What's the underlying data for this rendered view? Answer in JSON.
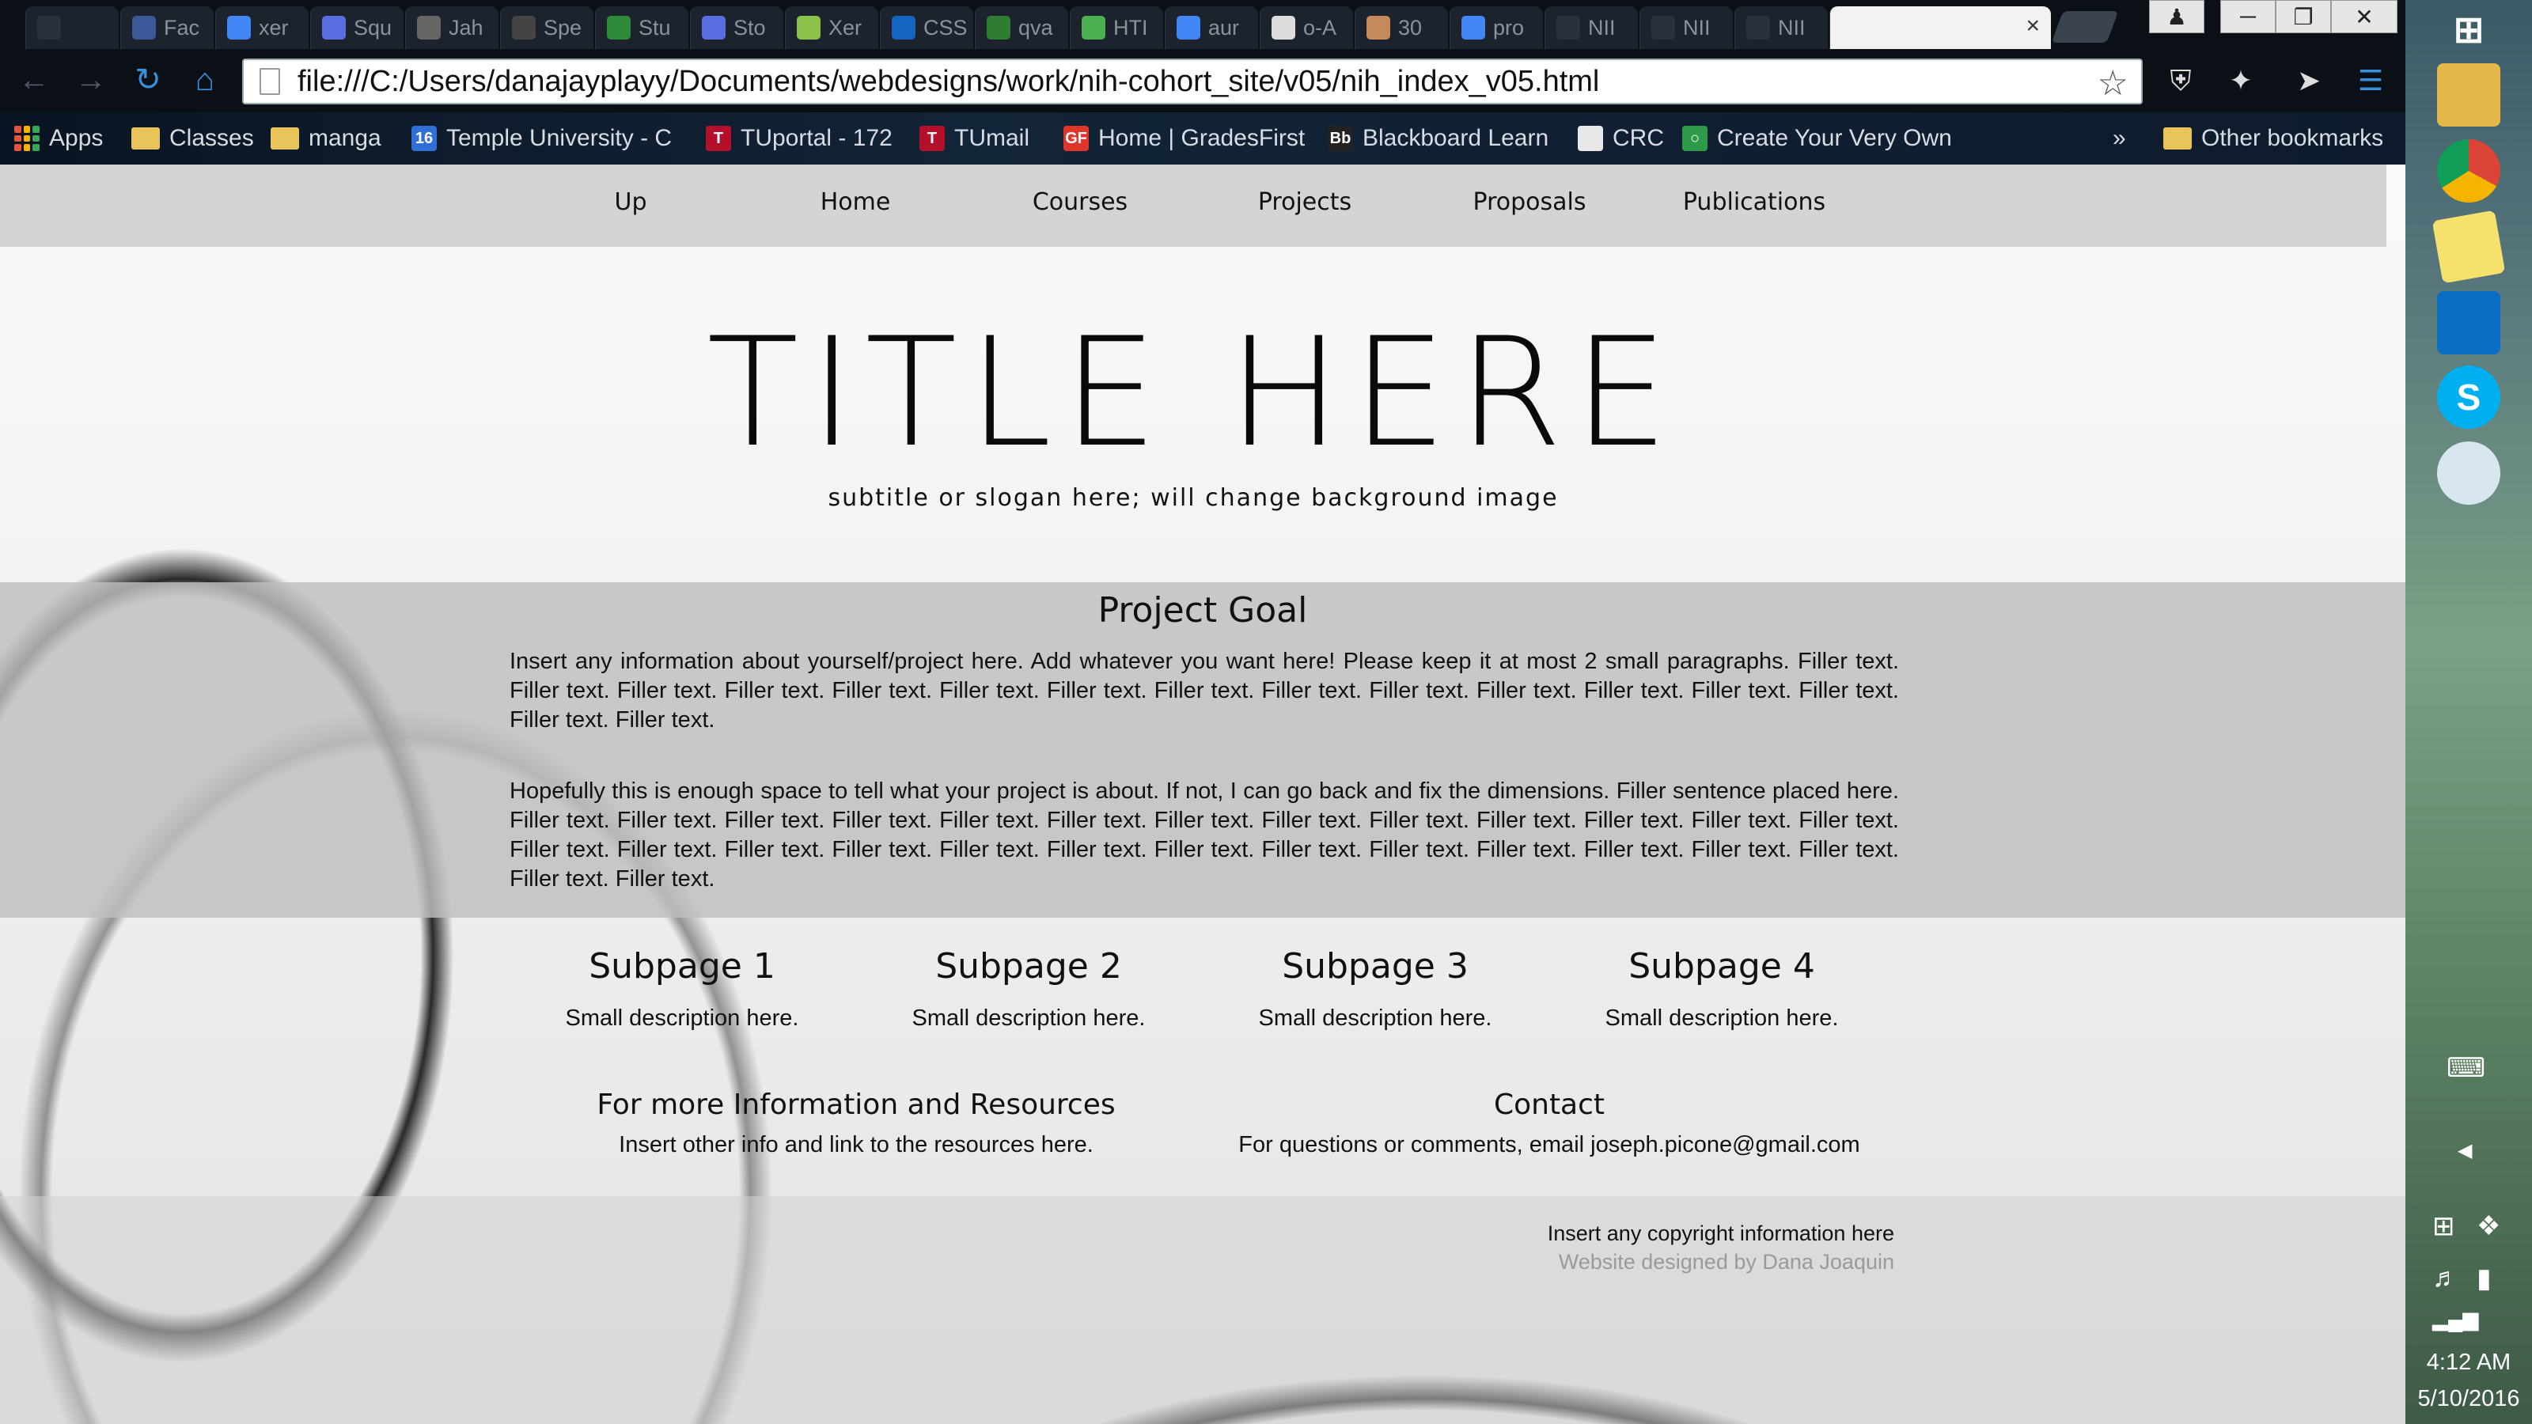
{
  "browser": {
    "tabs": [
      {
        "title": "",
        "favicon": "blank-page-icon",
        "color": "#2a313b"
      },
      {
        "title": "Fac",
        "favicon": "facebook-icon",
        "color": "#3b5998"
      },
      {
        "title": "xer",
        "favicon": "google-icon",
        "color": "#4285f4"
      },
      {
        "title": "Squ",
        "favicon": "gradient-g-icon",
        "color": "#5b6ee1"
      },
      {
        "title": "Jah",
        "favicon": "scissors-icon",
        "color": "#666666"
      },
      {
        "title": "Spe",
        "favicon": "check-icon",
        "color": "#444444"
      },
      {
        "title": "Stu",
        "favicon": "green-star-icon",
        "color": "#2e8b3a"
      },
      {
        "title": "Sto",
        "favicon": "gradient-g-icon",
        "color": "#5b6ee1"
      },
      {
        "title": "Xer",
        "favicon": "green-d-icon",
        "color": "#8bc34a"
      },
      {
        "title": "CSS",
        "favicon": "w3-icon",
        "color": "#1565c0"
      },
      {
        "title": "qva",
        "favicon": "green-circle-icon",
        "color": "#2e7d32"
      },
      {
        "title": "HTI",
        "favicon": "w3-green-icon",
        "color": "#4caf50"
      },
      {
        "title": "aur",
        "favicon": "google-icon",
        "color": "#4285f4"
      },
      {
        "title": "o-A",
        "favicon": "h-icon",
        "color": "#dddddd"
      },
      {
        "title": "30",
        "favicon": "avatar-icon",
        "color": "#c48a5a"
      },
      {
        "title": "pro",
        "favicon": "google-icon",
        "color": "#4285f4"
      },
      {
        "title": "NII",
        "favicon": "blank-page-icon",
        "color": "#2a313b"
      },
      {
        "title": "NII",
        "favicon": "blank-page-icon",
        "color": "#2a313b"
      },
      {
        "title": "NII",
        "favicon": "blank-page-icon",
        "color": "#2a313b"
      },
      {
        "title": "",
        "favicon": "blank-page-icon",
        "color": "#f2f2f2",
        "active": true
      }
    ],
    "url": "file:///C:/Users/danajayplayy/Documents/webdesigns/work/nih-cohort_site/v05/nih_index_v05.html",
    "bookmarks": [
      {
        "label": "Apps",
        "icon": "apps-grid-icon"
      },
      {
        "label": "Classes",
        "icon": "folder-icon"
      },
      {
        "label": "manga",
        "icon": "folder-icon"
      },
      {
        "label": "Temple University - C",
        "icon": "calendar-16-icon"
      },
      {
        "label": "TUportal - 172",
        "icon": "temple-t-icon"
      },
      {
        "label": "TUmail",
        "icon": "temple-t-icon"
      },
      {
        "label": "Home | GradesFirst",
        "icon": "gradesfirst-icon"
      },
      {
        "label": "Blackboard Learn",
        "icon": "blackboard-icon"
      },
      {
        "label": "CRC",
        "icon": "blank-page-icon"
      },
      {
        "label": "Create Your Very Own",
        "icon": "green-swirl-icon"
      }
    ],
    "other_bookmarks": "Other bookmarks",
    "overflow": "»"
  },
  "page": {
    "nav": [
      "Up",
      "Home",
      "Courses",
      "Projects",
      "Proposals",
      "Publications"
    ],
    "title": "TITLE HERE",
    "subtitle": "subtitle or slogan here; will change background image",
    "goal": {
      "heading": "Project Goal",
      "paragraphs": [
        "Insert any information about yourself/project here. Add whatever you want here! Please keep it at most 2 small paragraphs. Filler text. Filler text. Filler text. Filler text. Filler text. Filler text. Filler text. Filler text. Filler text. Filler text. Filler text. Filler text. Filler text. Filler text. Filler text. Filler text.",
        "Hopefully this is enough space to tell what your project is about. If not, I can go back and fix the dimensions. Filler sentence placed here. Filler text. Filler text. Filler text. Filler text. Filler text. Filler text. Filler text. Filler text. Filler text. Filler text. Filler text. Filler text. Filler text. Filler text. Filler text. Filler text. Filler text. Filler text. Filler text. Filler text. Filler text. Filler text. Filler text. Filler text. Filler text. Filler text. Filler text. Filler text."
      ]
    },
    "subpages": [
      {
        "title": "Subpage 1",
        "desc": "Small description here."
      },
      {
        "title": "Subpage 2",
        "desc": "Small description here."
      },
      {
        "title": "Subpage 3",
        "desc": "Small description here."
      },
      {
        "title": "Subpage 4",
        "desc": "Small description here."
      }
    ],
    "info": {
      "heading": "For more Information and Resources",
      "text": "Insert other info and link to the resources here."
    },
    "contact": {
      "heading": "Contact",
      "text": "For questions or comments, email joseph.picone@gmail.com"
    },
    "footer": {
      "copyright": "Insert any copyright information here",
      "designer": "Website designed by Dana Joaquin"
    }
  },
  "taskbar": {
    "pinned": [
      "windows-start-icon",
      "file-explorer-icon",
      "chrome-icon",
      "sticky-notes-icon",
      "outlook-icon",
      "skype-icon",
      "paint-icon"
    ],
    "time": "4:12 AM",
    "date": "5/10/2016"
  }
}
